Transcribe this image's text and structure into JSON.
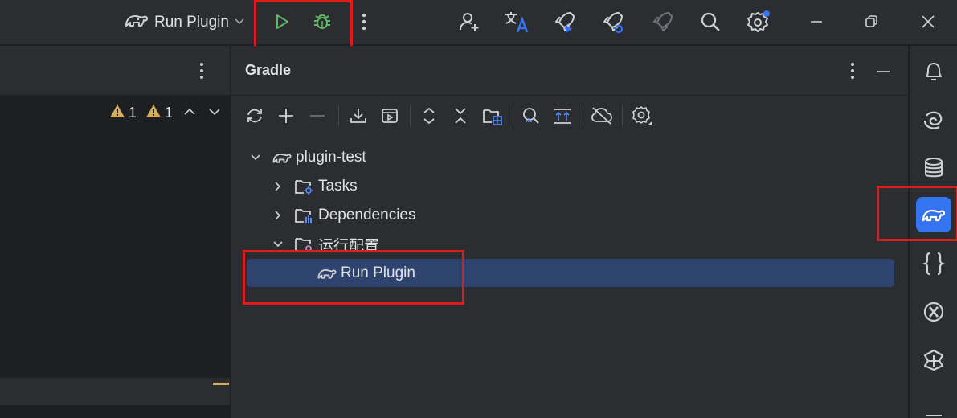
{
  "titlebar": {
    "run_config_label": "Run Plugin",
    "icons": [
      "gradle-elephant-icon",
      "chevron-down-icon",
      "run-icon",
      "debug-icon",
      "more-vertical-icon",
      "add-user-icon",
      "translate-icon",
      "rocket-play-icon",
      "rocket-gear-icon",
      "rocket-disabled-icon",
      "search-icon",
      "settings-icon",
      "minimize-icon",
      "restore-icon",
      "close-icon"
    ],
    "colors": {
      "run": "#5fb865",
      "debug": "#5fb865",
      "badge": "#3574f0"
    }
  },
  "editor": {
    "warning_count_1": "1",
    "warning_count_2": "1"
  },
  "gradle": {
    "title": "Gradle",
    "toolbar": [
      "reload-icon",
      "add-icon",
      "remove-icon",
      "download-icon",
      "run-task-icon",
      "expand-all-icon",
      "collapse-all-icon",
      "link-project-icon",
      "analyze-icon",
      "toggle-offline-icon",
      "offline-mode-icon",
      "gradle-settings-icon"
    ],
    "tree": {
      "root": "plugin-test",
      "tasks": "Tasks",
      "dependencies": "Dependencies",
      "run_configs": "运行配置",
      "run_plugin": "Run Plugin"
    }
  },
  "right_strip": {
    "icons": [
      "notifications-icon",
      "ai-assistant-icon",
      "database-icon",
      "gradle-icon",
      "json-icon",
      "plugin-x-icon",
      "devkit-icon",
      "more-icon"
    ],
    "active": "gradle-icon"
  }
}
